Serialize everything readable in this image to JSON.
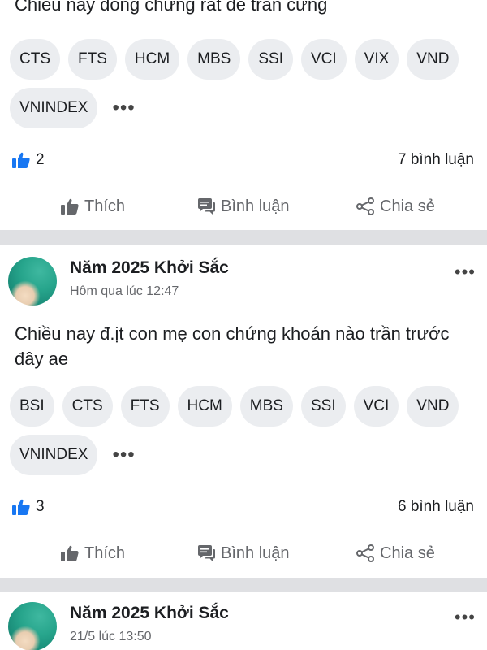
{
  "post_top": {
    "text_partial": "Chiều nay dòng chứng rất dễ trần cứng",
    "tags": [
      "CTS",
      "FTS",
      "HCM",
      "MBS",
      "SSI",
      "VCI",
      "VIX",
      "VND",
      "VNINDEX"
    ],
    "more_tags": "•••",
    "likes": "2",
    "comments": "7 bình luận"
  },
  "post_mid": {
    "author": "Năm 2025 Khởi Sắc",
    "time": "Hôm qua lúc 12:47",
    "text": "Chiều nay đ.ịt con mẹ con chứng khoán nào trần trước đây ae",
    "tags": [
      "BSI",
      "CTS",
      "FTS",
      "HCM",
      "MBS",
      "SSI",
      "VCI",
      "VND",
      "VNINDEX"
    ],
    "more_tags": "•••",
    "likes": "3",
    "comments": "6 bình luận"
  },
  "post_bottom": {
    "author": "Năm 2025 Khởi Sắc",
    "time": "21/5 lúc 13:50"
  },
  "actions": {
    "like": "Thích",
    "comment": "Bình luận",
    "share": "Chia sẻ"
  },
  "more_menu": "•••",
  "colors": {
    "like_blue": "#1877f2",
    "muted": "#65676b",
    "chip_bg": "#ebedf0",
    "separator": "#dfe0e3"
  }
}
